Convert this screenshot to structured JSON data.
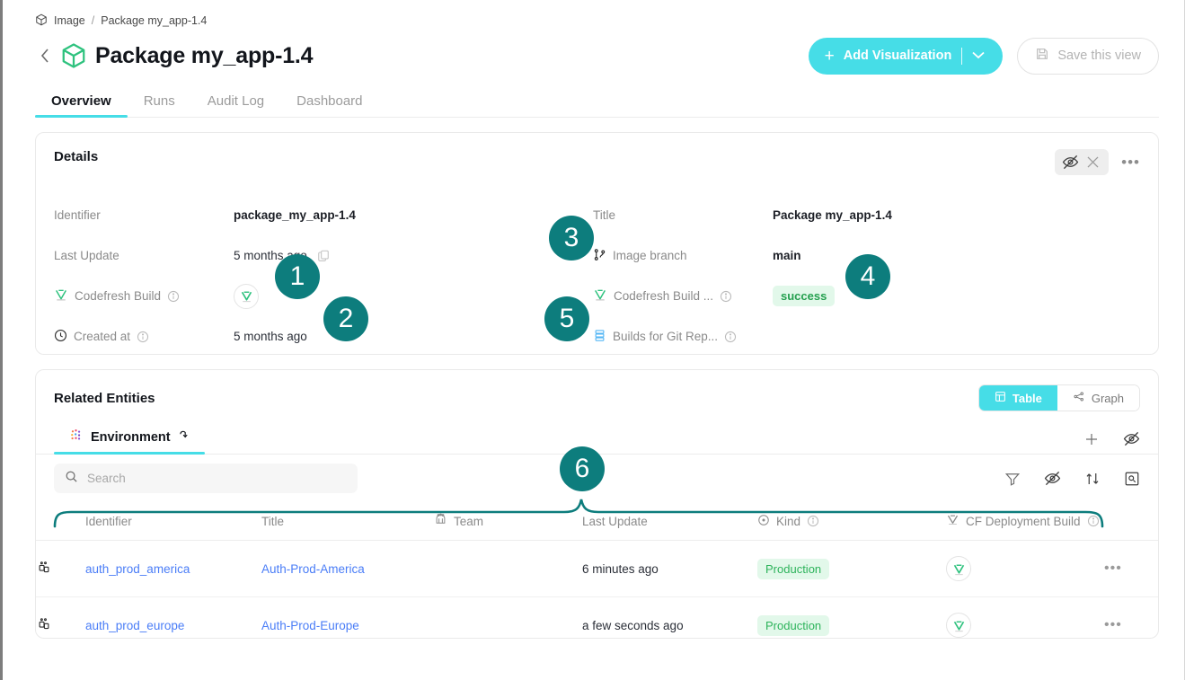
{
  "breadcrumb": {
    "root": "Image",
    "separator": "/",
    "current": "Package my_app-1.4"
  },
  "header": {
    "title": "Package my_app-1.4",
    "add_visualization_label": "Add Visualization",
    "save_view_label": "Save this view"
  },
  "tabs": [
    {
      "label": "Overview",
      "active": true
    },
    {
      "label": "Runs",
      "active": false
    },
    {
      "label": "Audit Log",
      "active": false
    },
    {
      "label": "Dashboard",
      "active": false
    }
  ],
  "details": {
    "title": "Details",
    "left": [
      {
        "label": "Identifier",
        "value": "package_my_app-1.4"
      },
      {
        "label": "Last Update",
        "value": "5 months ago"
      },
      {
        "label": "Codefresh Build",
        "value": ""
      },
      {
        "label": "Created at",
        "value": "5 months ago"
      }
    ],
    "right": [
      {
        "label": "Title",
        "value": "Package my_app-1.4"
      },
      {
        "label": "Image branch",
        "value": "main"
      },
      {
        "label": "Codefresh Build ...",
        "value": "success"
      },
      {
        "label": "Builds for Git Rep...",
        "value": ""
      }
    ]
  },
  "related": {
    "title": "Related Entities",
    "view_toggle": [
      {
        "label": "Table",
        "active": true
      },
      {
        "label": "Graph",
        "active": false
      }
    ],
    "tab_label": "Environment",
    "search_placeholder": "Search",
    "search_value": "",
    "columns": [
      "Identifier",
      "Title",
      "Team",
      "Last Update",
      "Kind",
      "CF Deployment Build"
    ],
    "rows": [
      {
        "identifier": "auth_prod_america",
        "title": "Auth-Prod-America",
        "team": "",
        "last_update": "6 minutes ago",
        "kind": "Production",
        "cf_build": "codefresh-logo"
      },
      {
        "identifier": "auth_prod_europe",
        "title": "Auth-Prod-Europe",
        "team": "",
        "last_update": "a few seconds ago",
        "kind": "Production",
        "cf_build": "codefresh-logo"
      }
    ]
  },
  "annotations": [
    {
      "number": "1"
    },
    {
      "number": "2"
    },
    {
      "number": "3"
    },
    {
      "number": "4"
    },
    {
      "number": "5"
    },
    {
      "number": "6"
    }
  ],
  "colors": {
    "accent": "#46dde7",
    "annotation": "#0d7d7d",
    "link": "#4a7df7",
    "success": "#25a04f"
  }
}
